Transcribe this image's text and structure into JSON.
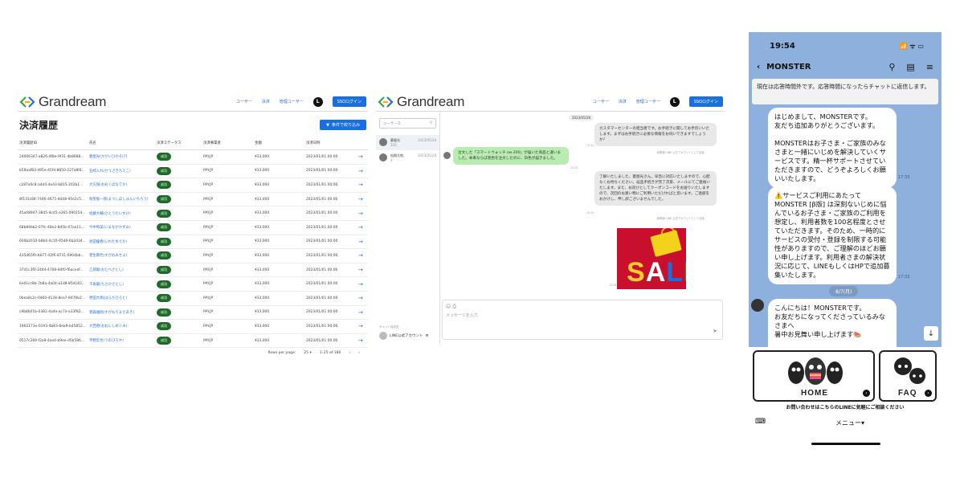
{
  "payment_panel": {
    "brand": "Grandream",
    "nav": [
      "ユーザー",
      "決済",
      "管理ユーザー"
    ],
    "avatar_letter": "L",
    "sso_label": "SSOログイン",
    "page_title": "決済履歴",
    "filter_label": "条件で絞り込み",
    "columns": [
      "決済履歴ID",
      "氏名",
      "決済ステータス",
      "決済事業者",
      "金額",
      "決済日時"
    ],
    "rows": [
      {
        "id": "24006347-a826-4f8e-9f31-4b8688...",
        "name": "菱屋光(かがいひかそげ)",
        "status": "成功",
        "provider": "PAY.JP",
        "amount": "¥33,000",
        "date": "2023/01/01 00:00"
      },
      {
        "id": "b59aaf83-d95e-45f4-8850-227a8f4...",
        "name": "石崎入れ(せうざきちえこ)",
        "status": "成功",
        "provider": "PAY.JP",
        "amount": "¥33,000",
        "date": "2023/01/01 00:00"
      },
      {
        "id": "c287a0c8-a4d4-4e43-b815-202b1...",
        "name": "大久保(おおくぼなてか)",
        "status": "成功",
        "provider": "PAY.JP",
        "amount": "¥33,000",
        "date": "2023/01/01 00:00"
      },
      {
        "id": "8f131c84-7446-4671-8448-95e2c5...",
        "name": "松柴俊一郎(まつしばしゅんいちろう)",
        "status": "成功",
        "provider": "PAY.JP",
        "amount": "¥33,000",
        "date": "2023/01/01 00:00"
      },
      {
        "id": "45a08947-3845-4cd5-a365-090154...",
        "name": "佐藤大輔(さとうだいすけ)",
        "status": "成功",
        "provider": "PAY.JP",
        "amount": "¥33,000",
        "date": "2023/01/01 00:00"
      },
      {
        "id": "68b84bb2-07fc-48e2-8d5b-07ae11...",
        "name": "今中和美(いまなかかずみ)",
        "status": "成功",
        "provider": "PAY.JP",
        "amount": "¥33,000",
        "date": "2023/01/01 00:00"
      },
      {
        "id": "600b2610-b8b4-4c10-95d9-6b2d34...",
        "name": "岩田優香(いわたゆうか)",
        "status": "成功",
        "provider": "PAY.JP",
        "amount": "¥33,000",
        "date": "2023/01/01 00:00"
      },
      {
        "id": "435d65f0-b677-42f6-8731-6904bb...",
        "name": "菅生節代(すがおみせよ)",
        "status": "成功",
        "provider": "PAY.JP",
        "amount": "¥33,000",
        "date": "2023/01/01 00:00"
      },
      {
        "id": "37d1c3f0-2444-4708-84f0-f6aceef...",
        "name": "乙部聡(おとべさとし)",
        "status": "成功",
        "provider": "PAY.JP",
        "amount": "¥33,000",
        "date": "2023/01/01 00:00"
      },
      {
        "id": "be01cc8b-7b8a-4a04-a1d8-85d183...",
        "name": "千坂聡(ちさかさとし)",
        "status": "成功",
        "provider": "PAY.JP",
        "amount": "¥33,000",
        "date": "2023/01/01 00:00"
      },
      {
        "id": "0bea8c2c-0460-4128-8ea7-8476b2...",
        "name": "原田大翔(はらだひろと)",
        "status": "成功",
        "provider": "PAY.JP",
        "amount": "¥33,000",
        "date": "2023/01/01 00:00"
      },
      {
        "id": "c9b8b01b-0381-4a4e-ac7a-a33f82...",
        "name": "菅森雅明(すがもりまさあき)",
        "status": "成功",
        "provider": "PAY.JP",
        "amount": "¥33,000",
        "date": "2023/01/01 00:00"
      },
      {
        "id": "1902173e-0193-4b83-8da9-b45852...",
        "name": "大西恵(おおにしめぐみ)",
        "status": "成功",
        "provider": "PAY.JP",
        "amount": "¥33,000",
        "date": "2023/01/01 00:00"
      },
      {
        "id": "0517c269-f2a9-4ae4-b9ee-d5b586...",
        "name": "宇野宏也(うのひろや)",
        "status": "成功",
        "provider": "PAY.JP",
        "amount": "¥33,000",
        "date": "2023/01/01 00:00"
      }
    ],
    "pager": {
      "rows_label": "Rows per page:",
      "rows_value": "25",
      "range": "1–25 of 180"
    }
  },
  "chat_panel": {
    "brand": "Grandream",
    "nav": [
      "ユーザー",
      "決済",
      "管理ユーザー"
    ],
    "avatar_letter": "L",
    "sso_label": "SSOログイン",
    "search_placeholder": "ユーザーを",
    "conversations": [
      {
        "name": "菱屋光",
        "sub": "333",
        "date": "2023/05/28"
      },
      {
        "name": "松崎大地",
        "sub": "3",
        "date": "2023/05/28"
      }
    ],
    "account_caption": "チャット対応先",
    "account_name": "LINE公式アカウント",
    "date_chip": "2023/05/28",
    "messages": [
      {
        "dir": "out",
        "text": "カスタマーセンターの担当者です。お手続きに関してお手伝いいたします。まずはお手続きに必要な情報をお伺いできますでしょうか？",
        "meta": "総務部 LINE 公式アカウントとして送信",
        "time": "13:11"
      },
      {
        "dir": "in",
        "text": "注文した「スマートウォッチ sw-200」が届いた商品と違いました。本来ならば黒色を注文したのに、白色が届きました。",
        "time": "13:15"
      },
      {
        "dir": "out",
        "text": "了解いたしました、菱屋光さん。早急に対応いたしますので、心配なくお待ちください。返品手続きが完了次第、メールにてご連絡いたします。また、お詫びとしてクーポンコードをお送りいたしますので、次回のお買い物にご利用いただければと思います。ご迷惑をおかけし、申し訳ございませんでした。",
        "meta": "総務部 LINE 公式アカウントとして送信",
        "time": "13:15"
      }
    ],
    "image_meta": "総務部 LINE 公式アカウントとして送信",
    "image_text": "SALE",
    "image_time": "13:16",
    "composer_placeholder": "メッセージを入力"
  },
  "phone": {
    "time": "19:54",
    "status_icons": "📶 ᯤ ▭",
    "title": "MONSTER",
    "notice": "現在は応答時間外です。応答時間になったらチャットに返信します。",
    "bubble1": "はじめまして、MONSTERです。\n友だち追加ありがとうございます。\n\nMONSTERはお子さま・ご家族のみなさまと一緒にいじめを解決していくサービスです。精一杯サポートさせていただきますので、どうぞよろしくお願いいたします。",
    "bubble1_time": "17:33",
    "bubble2": "⚠️サービスご利用にあたって\nMONSTER [β版] は深刻ないじめに悩んでいるお子さま・ご家族のご利用を想定し、利用者数を100名程度とさせていただきます。そのため、一時的にサービスの受付・登録を制限する可能性がありますので、ご理解のほどお願い申し上げます。利用者さまの解決状況に応じて、LINEもしくはHPで追加募集いたします。",
    "bubble2_time": "17:33",
    "date_pill": "8/7(月)",
    "bubble3": "こんにちは！MONSTERです。\nお友だちになってくださっているみなさまへ\n暑中お見舞い申し上げます🍉",
    "home_label": "HOME",
    "faq_label": "FAQ",
    "rich_note": "お問い合わせはこちらのLINEに気軽にご相談ください",
    "menu_label": "メニュー▾"
  }
}
